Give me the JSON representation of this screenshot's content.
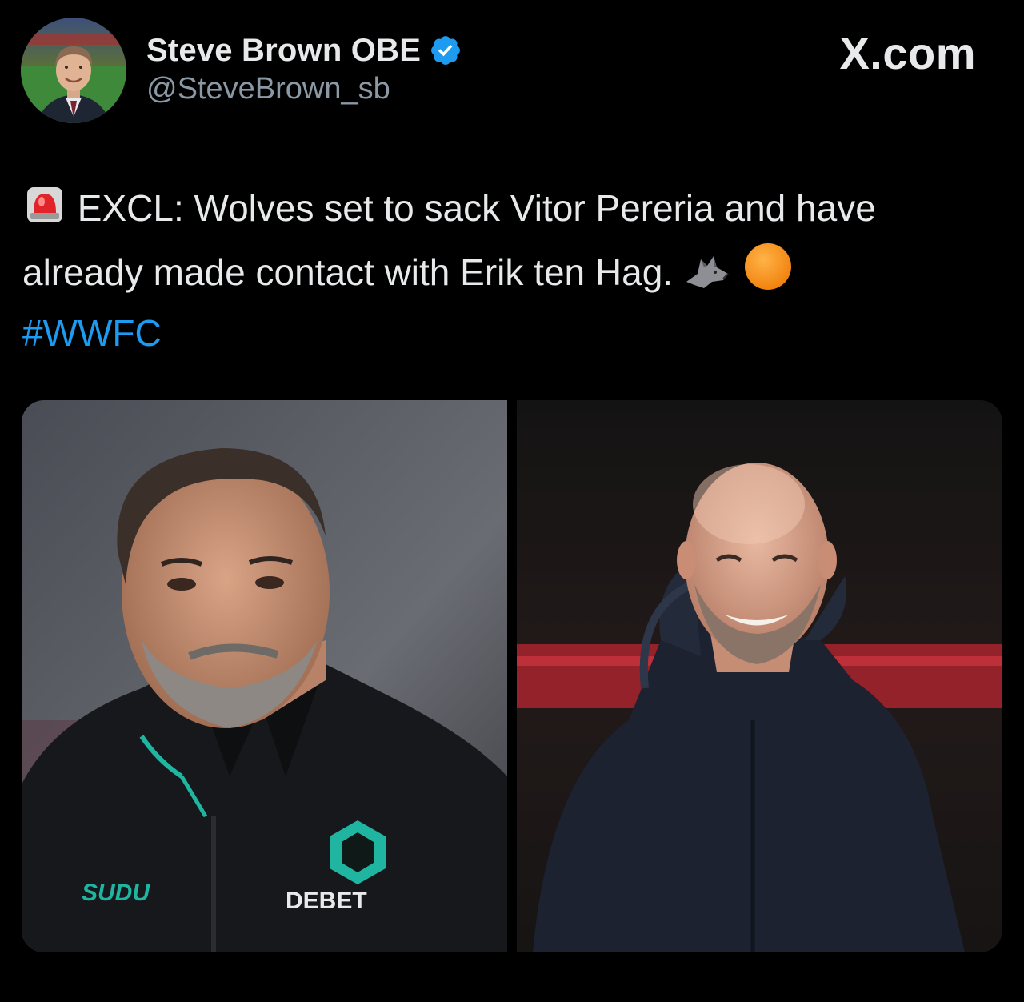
{
  "author": {
    "display_name": "Steve Brown OBE",
    "handle": "@SteveBrown_sb",
    "verified": true,
    "avatar_icon": "profile-photo"
  },
  "brand": {
    "label": "X.com"
  },
  "tweet": {
    "emoji_prefix": "siren-emoji",
    "line_1": "EXCL: Wolves set to sack Vitor Pereria and have",
    "line_2": "already made contact with Erik ten Hag.",
    "emoji_suffix": [
      "wolf-emoji",
      "orange-circle-emoji"
    ],
    "hashtag": "#WWFC"
  },
  "media": {
    "photos": [
      {
        "description_icon": "photo-manager-in-black-wolves-jacket",
        "jacket_text_left": "SUDU",
        "jacket_text_right": "DEBET"
      },
      {
        "description_icon": "photo-smiling-bald-manager-dark-jacket"
      }
    ]
  },
  "colors": {
    "background": "#000000",
    "text": "#e7e9ea",
    "secondary_text": "#8b98a5",
    "link": "#1d9bf0",
    "verified_badge": "#1d9bf0"
  }
}
